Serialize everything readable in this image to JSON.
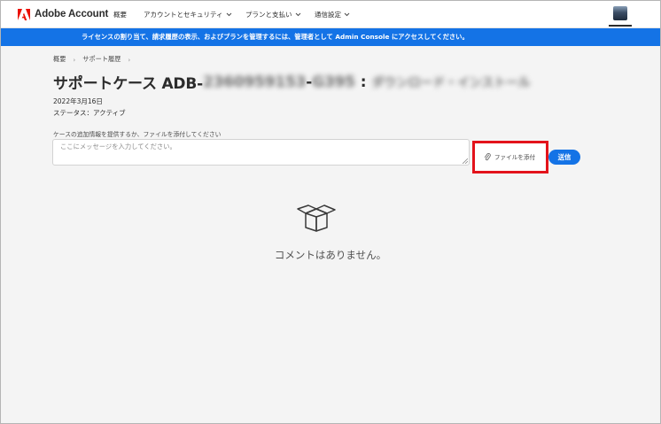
{
  "header": {
    "brand": "Adobe Account",
    "nav": [
      {
        "label": "概要",
        "has_menu": false
      },
      {
        "label": "アカウントとセキュリティ",
        "has_menu": true
      },
      {
        "label": "プランと支払い",
        "has_menu": true
      },
      {
        "label": "通信設定",
        "has_menu": true
      }
    ],
    "colors": {
      "brand_red": "#eb1000",
      "accent_blue": "#1473e6"
    }
  },
  "banner": {
    "text": "ライセンスの割り当て、請求履歴の表示、およびプランを管理するには、管理者として Admin Console にアクセスしてください。"
  },
  "breadcrumb": [
    "概要",
    "サポート履歴"
  ],
  "case": {
    "title_prefix": "サポートケース ADB-",
    "id_part1_redacted": "2360959153",
    "id_part2_redacted": "G395",
    "subject_redacted": "ダウンロード・インストール",
    "date": "2022年3月16日",
    "status": "ステータス：アクティブ"
  },
  "comment_form": {
    "label": "ケースの追加情報を提供するか、ファイルを添付してください",
    "placeholder": "ここにメッセージを入力してください。",
    "attach_label": "ファイルを添付",
    "send_label": "送信"
  },
  "empty_state": {
    "icon": "open-box-icon",
    "message": "コメントはありません。"
  }
}
